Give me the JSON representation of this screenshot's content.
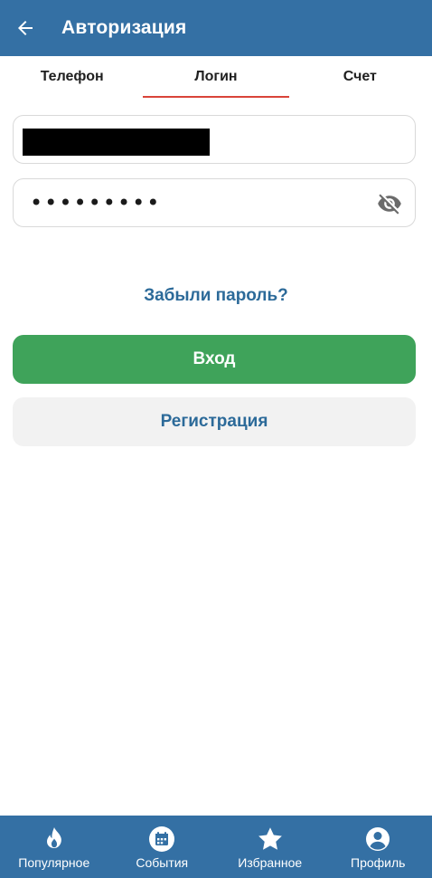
{
  "header": {
    "title": "Авторизация",
    "back_icon": "arrow-left-icon"
  },
  "tabs": [
    {
      "label": "Телефон",
      "active": false
    },
    {
      "label": "Логин",
      "active": true
    },
    {
      "label": "Счет",
      "active": false
    }
  ],
  "form": {
    "login_value": "",
    "password_value": "•••••••••",
    "visibility_icon": "eye-off-icon"
  },
  "actions": {
    "forgot_label": "Забыли пароль?",
    "login_label": "Вход",
    "register_label": "Регистрация"
  },
  "bottom_nav": [
    {
      "label": "Популярное",
      "icon": "flame-icon"
    },
    {
      "label": "События",
      "icon": "calendar-icon"
    },
    {
      "label": "Избранное",
      "icon": "star-icon"
    },
    {
      "label": "Профиль",
      "icon": "user-icon"
    }
  ],
  "colors": {
    "brand": "#3470a4",
    "accent_underline": "#d9443a",
    "login_button": "#3fa35a",
    "link": "#2c6a99"
  }
}
